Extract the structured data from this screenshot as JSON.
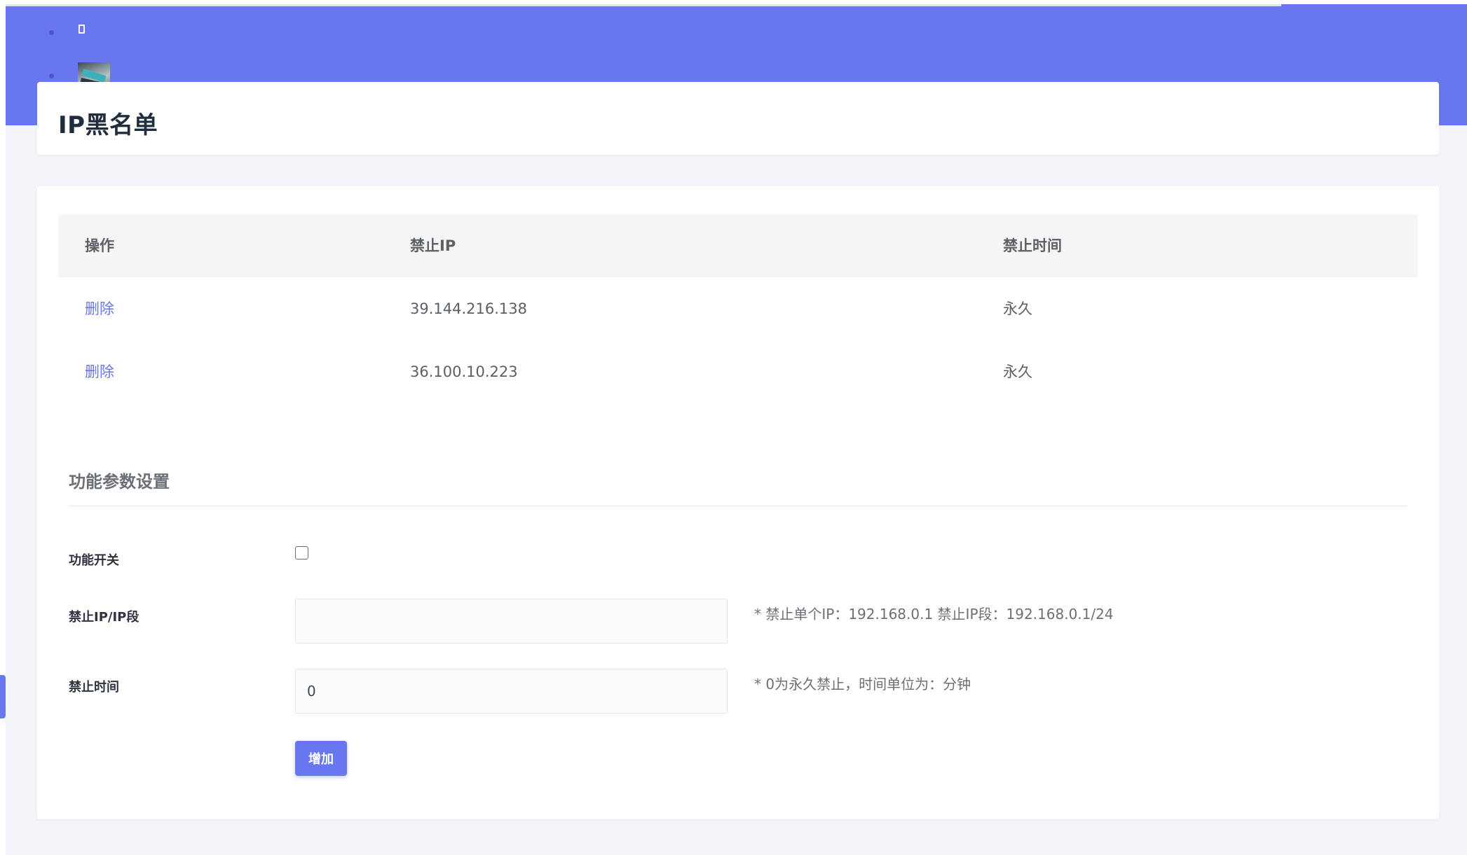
{
  "header": {
    "menu_icon": "sidebar-toggle-icon",
    "avatar": "user-avatar"
  },
  "page": {
    "title": "IP黑名单"
  },
  "table": {
    "columns": [
      "操作",
      "禁止IP",
      "禁止时间"
    ],
    "rows": [
      {
        "action": "删除",
        "ip": "39.144.216.138",
        "duration": "永久"
      },
      {
        "action": "删除",
        "ip": "36.100.10.223",
        "duration": "永久"
      }
    ]
  },
  "settings": {
    "section_title": "功能参数设置",
    "switch_label": "功能开关",
    "switch_checked": false,
    "ip_label": "禁止IP/IP段",
    "ip_value": "",
    "ip_hint": "* 禁止单个IP：192.168.0.1   禁止IP段：192.168.0.1/24",
    "time_label": "禁止时间",
    "time_value": "0",
    "time_hint": "* 0为永久禁止，时间单位为：分钟",
    "add_button": "增加"
  },
  "colors": {
    "accent": "#6877f0",
    "background": "#f4f5f9",
    "card": "#ffffff"
  }
}
